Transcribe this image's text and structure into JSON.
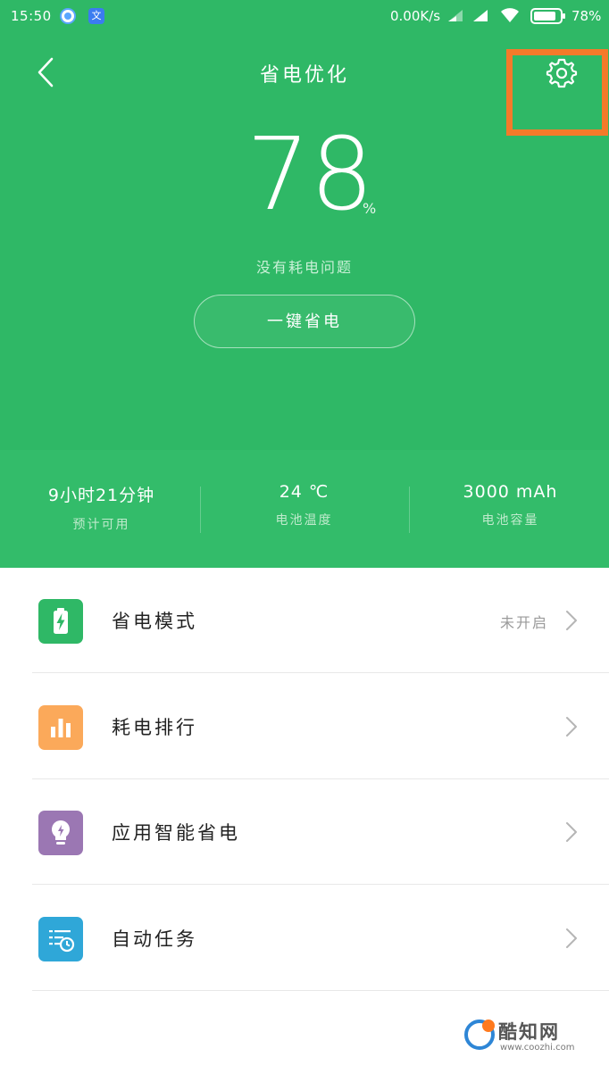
{
  "status_bar": {
    "time": "15:50",
    "app_icon_2_text": "文",
    "net_speed": "0.00K/s",
    "battery_percent": "78%"
  },
  "header": {
    "title": "省电优化"
  },
  "battery": {
    "value": "78",
    "unit": "%",
    "message": "没有耗电问题",
    "optimize_button": "一键省电"
  },
  "stats": [
    {
      "value": "9小时21分钟",
      "label": "预计可用"
    },
    {
      "value": "24 ℃",
      "label": "电池温度"
    },
    {
      "value": "3000 mAh",
      "label": "电池容量"
    }
  ],
  "menu": [
    {
      "label": "省电模式",
      "status": "未开启",
      "icon": "battery-charge-icon",
      "color": "#2fb866"
    },
    {
      "label": "耗电排行",
      "status": "",
      "icon": "bar-chart-icon",
      "color": "#fba95a"
    },
    {
      "label": "应用智能省电",
      "status": "",
      "icon": "bulb-icon",
      "color": "#9b77b3"
    },
    {
      "label": "自动任务",
      "status": "",
      "icon": "task-clock-icon",
      "color": "#2fa7d8"
    }
  ],
  "watermark": {
    "title": "酷知网",
    "url": "www.coozhi.com"
  },
  "colors": {
    "hero": "#2fb866",
    "highlight": "#f47a2a"
  }
}
